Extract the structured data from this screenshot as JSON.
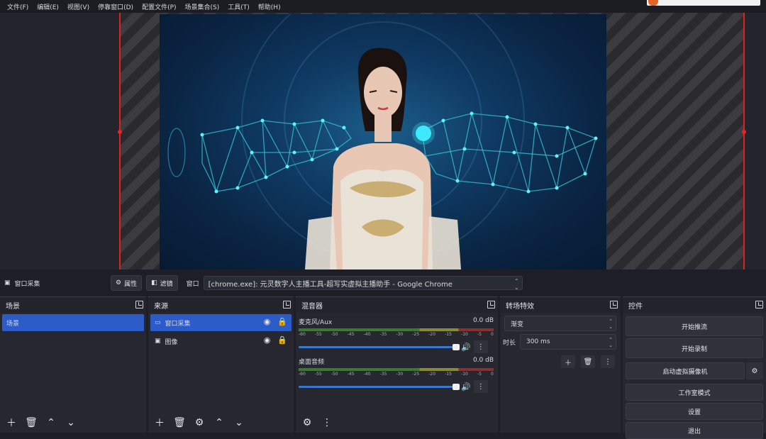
{
  "menu": [
    "文件(F)",
    "编辑(E)",
    "视图(V)",
    "停靠窗口(D)",
    "配置文件(P)",
    "场景集合(S)",
    "工具(T)",
    "帮助(H)"
  ],
  "source_bar": {
    "source_name": "窗口采集",
    "properties_label": "属性",
    "filters_label": "滤镜",
    "window_label": "窗口",
    "window_value": "[chrome.exe]: 元灵数字人主播工具-超写实虚拟主播助手 - Google Chrome"
  },
  "docks": {
    "scenes": {
      "title": "场景",
      "items": [
        "场景"
      ]
    },
    "sources": {
      "title": "来源",
      "items": [
        "窗口采集",
        "图像"
      ]
    },
    "mixer": {
      "title": "混音器",
      "channels": [
        {
          "name": "麦克风/Aux",
          "level": "0.0 dB"
        },
        {
          "name": "桌面音频",
          "level": "0.0 dB"
        }
      ],
      "scale": [
        "-60",
        "-55",
        "-50",
        "-45",
        "-40",
        "-35",
        "-30",
        "-25",
        "-20",
        "-15",
        "-10",
        "-5",
        "0"
      ]
    },
    "transitions": {
      "title": "转场特效",
      "type": "渐变",
      "duration_label": "时长",
      "duration_value": "300 ms"
    },
    "controls": {
      "title": "控件",
      "buttons": [
        "开始推流",
        "开始录制",
        "启动虚拟摄像机",
        "工作室模式",
        "设置",
        "退出"
      ]
    }
  }
}
